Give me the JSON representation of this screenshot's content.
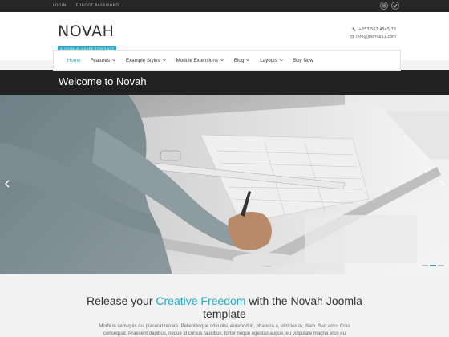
{
  "topbar": {
    "login": "LOGIN",
    "forgot": "FORGOT PASSWORD",
    "social": [
      "instagram-icon",
      "vimeo-icon"
    ]
  },
  "logo": {
    "name": "NOVAH",
    "tagline": "A JOOMLA!-BASED TEMPLATE"
  },
  "contact": {
    "phone": "+353 567 4545 78",
    "email": "info@joomla51.com"
  },
  "nav": {
    "items": [
      {
        "label": "Home",
        "active": true,
        "caret": false
      },
      {
        "label": "Features",
        "caret": true
      },
      {
        "label": "Example Styles",
        "caret": true
      },
      {
        "label": "Module Extensions",
        "caret": true
      },
      {
        "label": "Blog",
        "caret": true
      },
      {
        "label": "Layouts",
        "caret": true
      },
      {
        "label": "Buy Now",
        "caret": false
      }
    ]
  },
  "welcome": "Welcome to Novah",
  "hero": {
    "slides": 3,
    "active_slide": 0
  },
  "release": {
    "pre": "Release your",
    "highlight": "Creative Freedom",
    "post": "with the Novah Joomla template",
    "body": "Morbi in sem quis dui placerat ornare. Pellentesque odio nisi, euismod in, pharetra a, ultricies in, diam. Sed arcu. Cras consequat. Praesent dapibus, neque id cursus faucibus, tortor neque egestas augue, eu vulputate magna eros eu"
  },
  "colors": {
    "accent": "#2aa7c0",
    "dark": "#222222",
    "topbar": "#262626"
  }
}
